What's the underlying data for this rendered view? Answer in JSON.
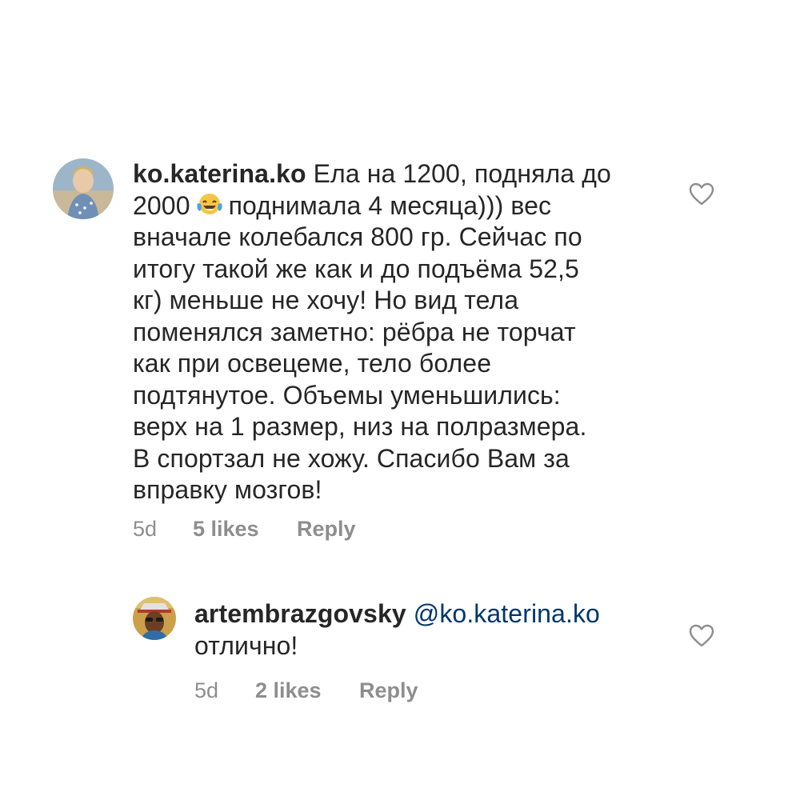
{
  "comments": [
    {
      "username": "ko.katerina.ko",
      "text_lines": [
        "Ела на 1200, подняла до",
        "поднимала 4 месяца))) вес",
        "вначале колебался 800 гр. Сейчас по",
        "итогу такой же как и до подъёма 52,5",
        "кг) меньше не хочу! Но вид тела",
        "поменялся заметно: рёбра не торчат",
        "как при освецеме, тело более",
        "подтянутое. Объемы уменьшились:",
        "верх на 1 размер, низ на полразмера.",
        "В спортзал не хожу. Спасибо Вам за",
        "вправку мозгов!"
      ],
      "line2_prefix": "2000",
      "emoji": "face-with-tears-of-joy",
      "time": "5d",
      "likes": "5 likes",
      "reply_label": "Reply",
      "icon": "heart-outline-icon"
    },
    {
      "username": "artembrazgovsky",
      "mention": "@ko.katerina.ko",
      "text": "отлично!",
      "time": "5d",
      "likes": "2 likes",
      "reply_label": "Reply",
      "icon": "heart-outline-icon"
    }
  ],
  "colors": {
    "text": "#262626",
    "secondary": "#8e8e8e",
    "mention": "#00376b"
  }
}
